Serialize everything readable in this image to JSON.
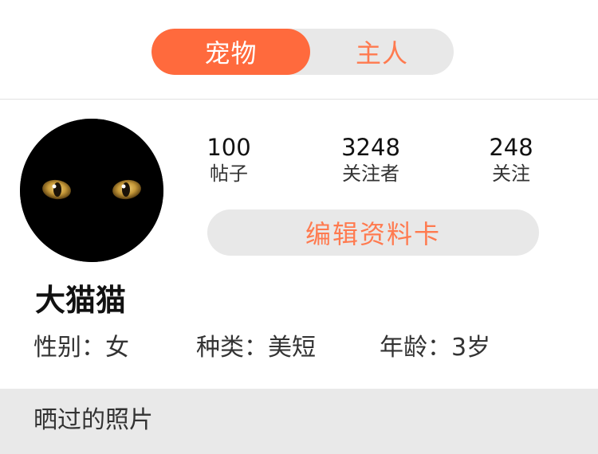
{
  "tabs": {
    "pet_label": "宠物",
    "owner_label": "主人"
  },
  "profile": {
    "avatar_icon": "black-cat-eyes-avatar",
    "stats": [
      {
        "value": "100",
        "label": "帖子"
      },
      {
        "value": "3248",
        "label": "关注者"
      },
      {
        "value": "248",
        "label": "关注"
      }
    ],
    "edit_label": "编辑资料卡",
    "name": "大猫猫",
    "gender": "性别：女",
    "breed": "种类：美短",
    "age": "年龄：3岁"
  },
  "photos": {
    "title": "晒过的照片"
  },
  "colors": {
    "accent": "#ff6a3d",
    "accent_text": "#ff7a4f",
    "pill_bg": "#e8e8e8",
    "section_bg": "#e9e9e9"
  }
}
